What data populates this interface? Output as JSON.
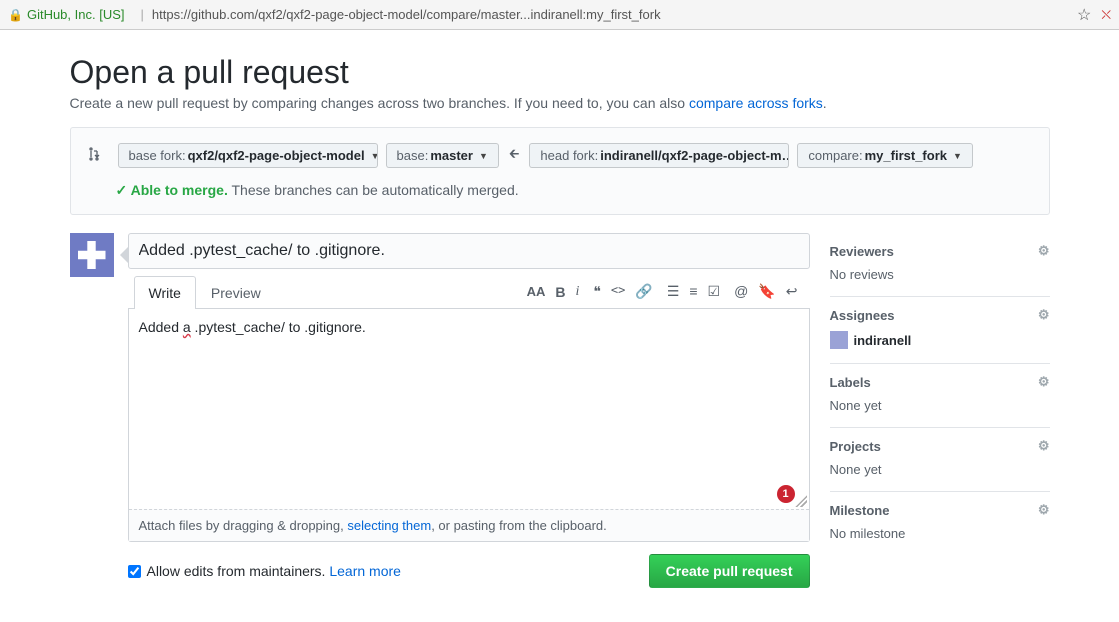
{
  "browser": {
    "site_label": "GitHub, Inc. [US]",
    "url": "https://github.com/qxf2/qxf2-page-object-model/compare/master...indiranell:my_first_fork"
  },
  "page": {
    "title": "Open a pull request",
    "subheader_prefix": "Create a new pull request by comparing changes across two branches. If you need to, you can also ",
    "compare_forks_link": "compare across forks",
    "subheader_suffix": "."
  },
  "range": {
    "base_fork_label": "base fork: ",
    "base_fork_value": "qxf2/qxf2-page-object-model",
    "base_label": "base: ",
    "base_value": "master",
    "head_fork_label": "head fork: ",
    "head_fork_value": "indiranell/qxf2-page-object-m…",
    "compare_label": "compare: ",
    "compare_value": "my_first_fork",
    "merge_status_strong": "✓ Able to merge.",
    "merge_status_text": " These branches can be automatically merged."
  },
  "form": {
    "title_value": "Added .pytest_cache/ to .gitignore.",
    "tabs": {
      "write": "Write",
      "preview": "Preview"
    },
    "body_prefix": "Added ",
    "body_spell": "a",
    "body_suffix": " .pytest_cache/ to .gitignore.",
    "badge": "1",
    "attach_prefix": "Attach files by dragging & dropping, ",
    "attach_link": "selecting them",
    "attach_suffix": ", or pasting from the clipboard.",
    "allow_edits_label": "Allow edits from maintainers. ",
    "learn_more": "Learn more",
    "create_button": "Create pull request"
  },
  "toolbar_icons": {
    "text_size": "AA",
    "bold": "B",
    "italic": "i",
    "quote": "❝",
    "code": "<>",
    "link": "🔗",
    "ul": "☰",
    "ol": "≡",
    "task": "☑",
    "mention": "@",
    "bookmark": "🔖",
    "reply": "↩"
  },
  "sidebar": {
    "reviewers": {
      "title": "Reviewers",
      "body": "No reviews"
    },
    "assignees": {
      "title": "Assignees",
      "user": "indiranell"
    },
    "labels": {
      "title": "Labels",
      "body": "None yet"
    },
    "projects": {
      "title": "Projects",
      "body": "None yet"
    },
    "milestone": {
      "title": "Milestone",
      "body": "No milestone"
    }
  }
}
